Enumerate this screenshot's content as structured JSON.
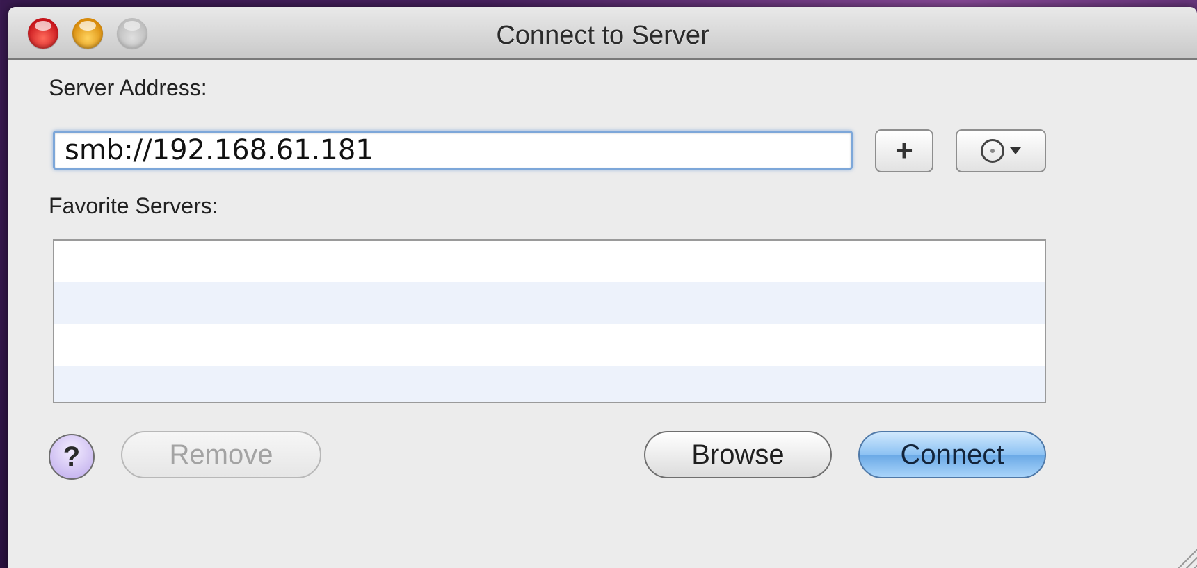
{
  "window": {
    "title": "Connect to Server"
  },
  "server_address": {
    "label": "Server Address:",
    "value": "smb://192.168.61.181"
  },
  "buttons": {
    "add_favorite": "+",
    "help": "?",
    "remove": "Remove",
    "browse": "Browse",
    "connect": "Connect"
  },
  "favorites": {
    "label": "Favorite Servers:",
    "items": []
  },
  "colors": {
    "accent": "#7da7d9",
    "connect_button": "#8dc2f3"
  },
  "icons": {
    "recent_servers": "clock-icon",
    "menu_caret": "caret-down-icon"
  }
}
